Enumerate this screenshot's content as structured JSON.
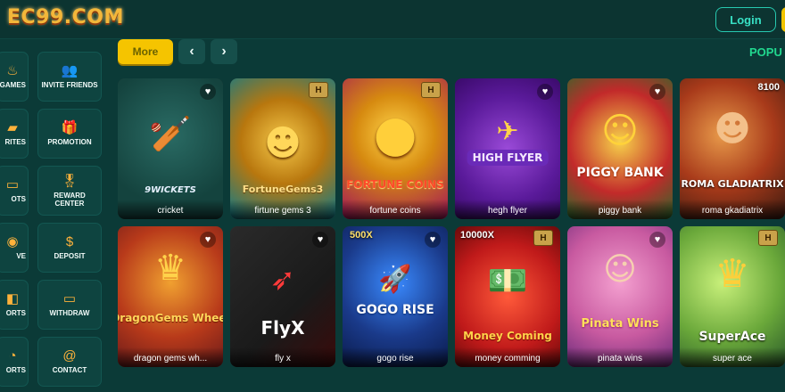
{
  "header": {
    "logo": "EC99.COM",
    "login_label": "Login"
  },
  "sidebar": {
    "items": [
      {
        "label": "GAMES",
        "icon": "fire-icon"
      },
      {
        "label": "INVITE FRIENDS",
        "icon": "friends-icon"
      },
      {
        "label": "RITES",
        "icon": "favorites-icon"
      },
      {
        "label": "PROMOTION",
        "icon": "gift-icon"
      },
      {
        "label": "OTS",
        "icon": "slots-icon"
      },
      {
        "label": "REWARD CENTER",
        "icon": "medal-icon"
      },
      {
        "label": "VE",
        "icon": "live-icon"
      },
      {
        "label": "DEPOSIT",
        "icon": "dollar-icon"
      },
      {
        "label": "ORTS",
        "icon": "sports-icon"
      },
      {
        "label": "WITHDRAW",
        "icon": "withdraw-icon"
      },
      {
        "label": "ORTS",
        "icon": "esports-icon"
      },
      {
        "label": "CONTACT",
        "icon": "at-icon"
      }
    ]
  },
  "main": {
    "more_label": "More",
    "prev_icon": "‹",
    "next_icon": "›",
    "section_label": "POPU",
    "games": [
      {
        "name": "cricket",
        "brand": "9WICKETS",
        "badge": ""
      },
      {
        "name": "firtune gems 3",
        "brand": "FortuneGems3",
        "badge": ""
      },
      {
        "name": "fortune coins",
        "brand": "FORTUNE COINS",
        "badge": ""
      },
      {
        "name": "hegh flyer",
        "brand": "HIGH FLYER",
        "badge": ""
      },
      {
        "name": "piggy bank",
        "brand": "PIGGY BANK",
        "badge": ""
      },
      {
        "name": "roma gkadiatrix",
        "brand": "ROMA GLADIATRIX",
        "badge": "8100"
      },
      {
        "name": "dragon gems wh...",
        "brand": "DragonGems Wheel",
        "badge": ""
      },
      {
        "name": "fly x",
        "brand": "FlyX",
        "badge": ""
      },
      {
        "name": "gogo rise",
        "brand": "GOGO RISE",
        "badge": "500X"
      },
      {
        "name": "money comming",
        "brand": "Money Coming",
        "badge": "10000X"
      },
      {
        "name": "pinata wins",
        "brand": "Pinata Wins",
        "badge": ""
      },
      {
        "name": "super ace",
        "brand": "SuperAce",
        "badge": ""
      }
    ]
  },
  "colors": {
    "accent_teal": "#27c9b0",
    "more_yellow": "#f5c400",
    "section_green": "#21d88f"
  }
}
